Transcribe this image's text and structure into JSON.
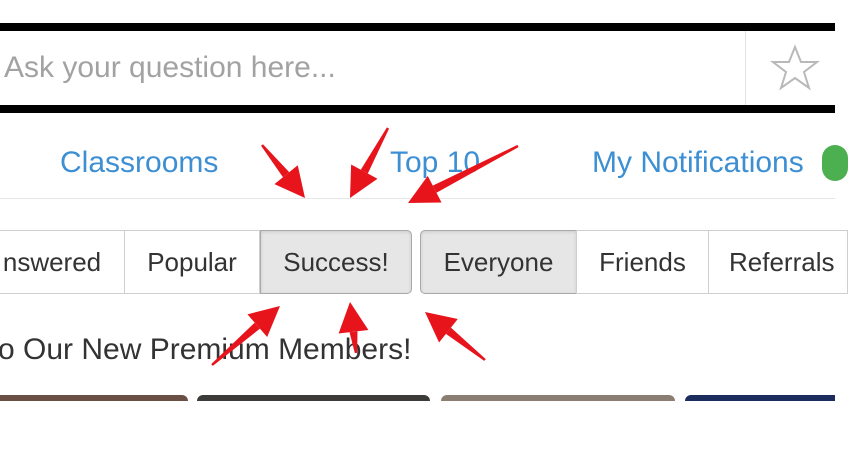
{
  "search": {
    "placeholder": "Ask your question here...",
    "star_icon": "star-outline-icon"
  },
  "nav": {
    "links": [
      "Classrooms",
      "Top 10",
      "My Notifications"
    ]
  },
  "tabs": [
    {
      "label": "nswered",
      "active": false
    },
    {
      "label": "Popular",
      "active": false
    },
    {
      "label": "Success!",
      "active": true
    },
    {
      "label": "Everyone",
      "active": true
    },
    {
      "label": "Friends",
      "active": false
    },
    {
      "label": "Referrals",
      "active": false
    }
  ],
  "section": {
    "heading": "o Our New Premium Members!"
  },
  "annotations": {
    "arrow_color": "#e8141c"
  },
  "colors": {
    "link": "#3d8fd3",
    "notification_badge": "#4caf50",
    "active_tab_bg": "#e6e6e6"
  }
}
